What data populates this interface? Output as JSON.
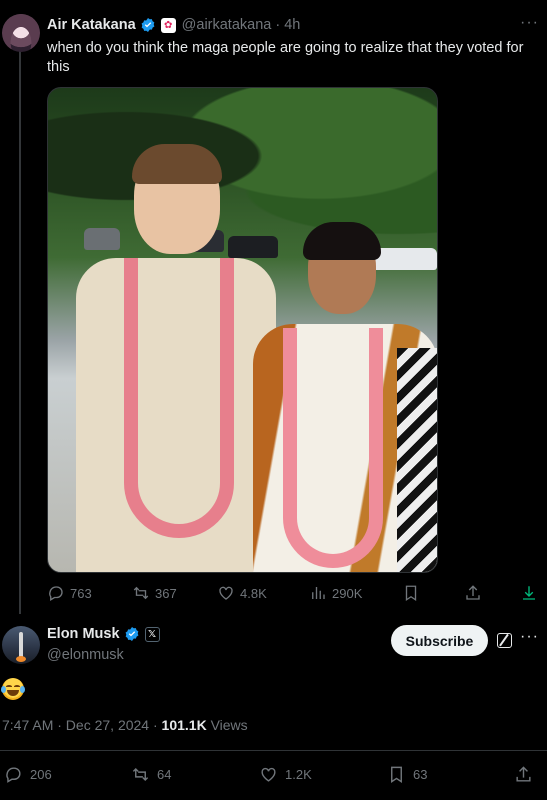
{
  "quoted_post": {
    "display_name": "Air Katakana",
    "handle": "@airkatakana",
    "separator": "·",
    "time": "4h",
    "text": "when do you think the maga people are going to realize that they voted for this",
    "actions": {
      "replies": "763",
      "reposts": "367",
      "likes": "4.8K",
      "views": "290K"
    }
  },
  "main_post": {
    "display_name": "Elon Musk",
    "handle": "@elonmusk",
    "subscribe_label": "Subscribe",
    "timestamp": "7:47 AM · Dec 27, 2024 ·",
    "views_count": "101.1K",
    "views_label": "Views",
    "actions": {
      "replies": "206",
      "reposts": "64",
      "likes": "1.2K",
      "bookmarks": "63"
    }
  },
  "colors": {
    "background": "#000000",
    "text_primary": "#e7e9ea",
    "text_secondary": "#71767b",
    "verified_blue": "#1d9bf0",
    "download_green": "#00ba7c",
    "border": "#2f3336"
  },
  "icons": [
    "reply-icon",
    "repost-icon",
    "like-icon",
    "views-icon",
    "bookmark-icon",
    "share-icon",
    "download-icon",
    "verified-icon",
    "more-icon",
    "grok-icon",
    "x-affiliate-icon",
    "laughing-emoji"
  ]
}
